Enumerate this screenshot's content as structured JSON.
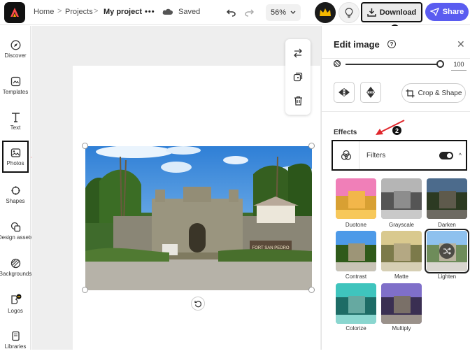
{
  "topbar": {
    "breadcrumb_home": "Home",
    "breadcrumb_projects": "Projects",
    "project_name": "My project",
    "more": "•••",
    "save_status": "Saved",
    "zoom": "56%",
    "download_label": "Download",
    "share_label": "Share"
  },
  "sidebar": {
    "items": [
      {
        "label": "Discover",
        "icon": "compass-icon"
      },
      {
        "label": "Templates",
        "icon": "templates-icon"
      },
      {
        "label": "Text",
        "icon": "text-icon"
      },
      {
        "label": "Photos",
        "icon": "photo-icon"
      },
      {
        "label": "Shapes",
        "icon": "shapes-icon"
      },
      {
        "label": "Design assets",
        "icon": "design-assets-icon"
      },
      {
        "label": "Backgrounds",
        "icon": "backgrounds-icon"
      },
      {
        "label": "Logos",
        "icon": "logos-icon"
      },
      {
        "label": "Libraries",
        "icon": "libraries-icon"
      }
    ]
  },
  "canvas": {
    "photo_sign_text": "FORT SAN PEDRO"
  },
  "panel": {
    "title": "Edit image",
    "slider_value": "100",
    "crop_label": "Crop & Shape",
    "effects_label": "Effects",
    "filters_label": "Filters",
    "filters_enabled": true,
    "filters": [
      {
        "label": "Duotone"
      },
      {
        "label": "Grayscale"
      },
      {
        "label": "Darken"
      },
      {
        "label": "Contrast"
      },
      {
        "label": "Matte"
      },
      {
        "label": "Lighten",
        "selected": true
      },
      {
        "label": "Colorize"
      },
      {
        "label": "Multiply"
      }
    ]
  },
  "annotations": {
    "step1": "1",
    "step2": "2",
    "step3": "3"
  },
  "colors": {
    "accent": "#5a5cf0",
    "annotation_arrow": "#e0262b"
  }
}
